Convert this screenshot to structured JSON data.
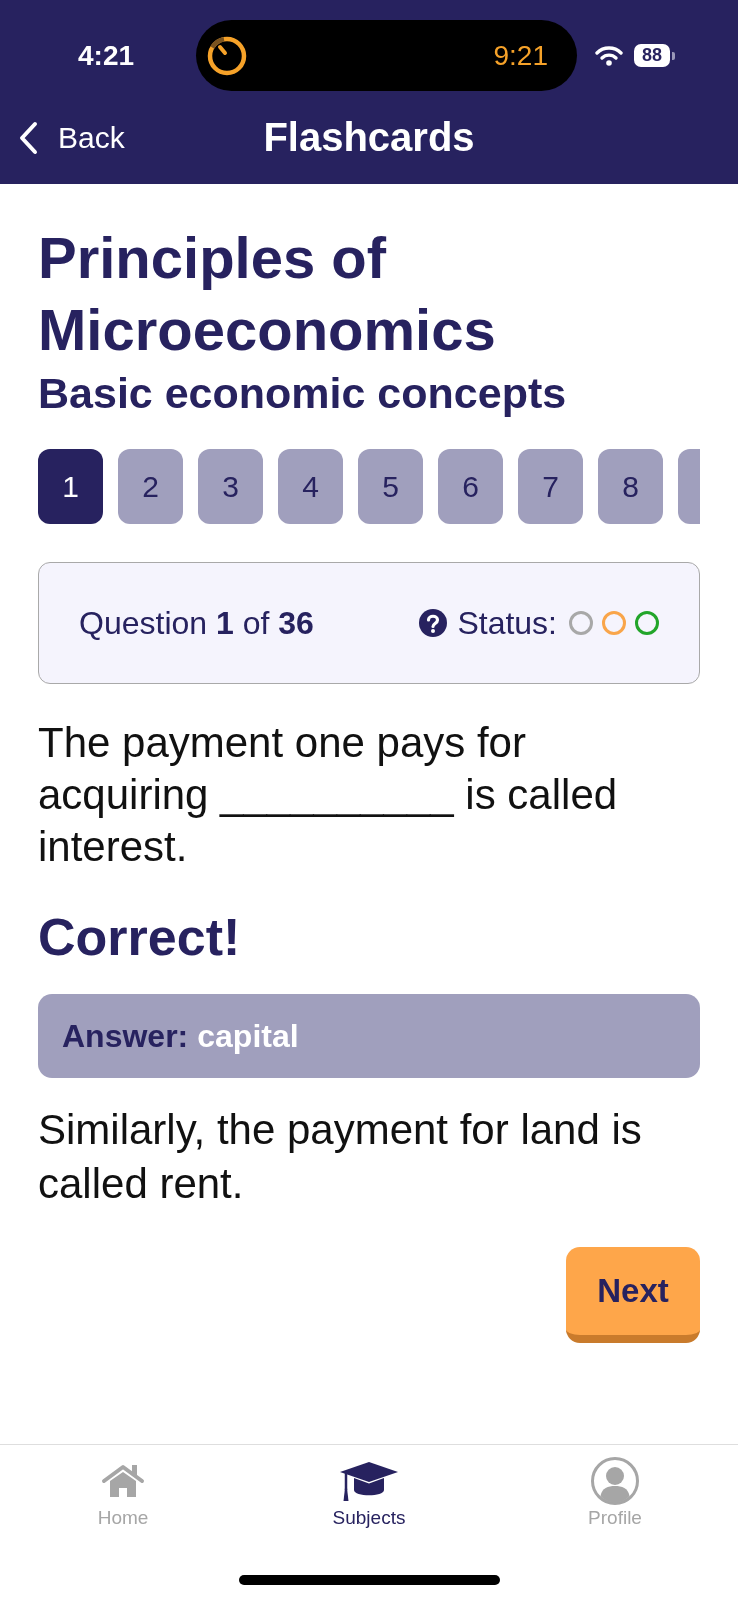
{
  "status_bar": {
    "time": "4:21",
    "timer": "9:21",
    "battery": "88"
  },
  "nav_bar": {
    "back": "Back",
    "title": "Flashcards"
  },
  "course": {
    "title": "Principles of Microeconomics",
    "topic": "Basic economic concepts"
  },
  "question_tabs": [
    {
      "label": "1",
      "selected": true,
      "cut_off": false
    },
    {
      "label": "2",
      "selected": false,
      "cut_off": false
    },
    {
      "label": "3",
      "selected": false,
      "cut_off": false
    },
    {
      "label": "4",
      "selected": false,
      "cut_off": false
    },
    {
      "label": "5",
      "selected": false,
      "cut_off": false
    },
    {
      "label": "6",
      "selected": false,
      "cut_off": false
    },
    {
      "label": "7",
      "selected": false,
      "cut_off": false
    },
    {
      "label": "8",
      "selected": false,
      "cut_off": false
    },
    {
      "selected": false,
      "cut_off": true
    }
  ],
  "question_info": {
    "text": "Question **1** of **36**",
    "status_label": "Status:",
    "status_rings": [
      {
        "color": "#a8a8a8"
      },
      {
        "color": "#f9a54a"
      },
      {
        "color": "#22a52a"
      }
    ]
  },
  "question": "The payment one pays for acquiring __________ is called interest.",
  "result": "Correct!",
  "answer": {
    "label": "Answer:",
    "value": "capital"
  },
  "explanation": "Similarly, the payment for land is called rent.",
  "next_button": "Next",
  "tab_bar": [
    {
      "kind": "home",
      "label": "Home",
      "selected": false
    },
    {
      "kind": "cap",
      "label": "Subjects",
      "selected": true
    },
    {
      "kind": "profile",
      "label": "Profile",
      "selected": false
    }
  ]
}
